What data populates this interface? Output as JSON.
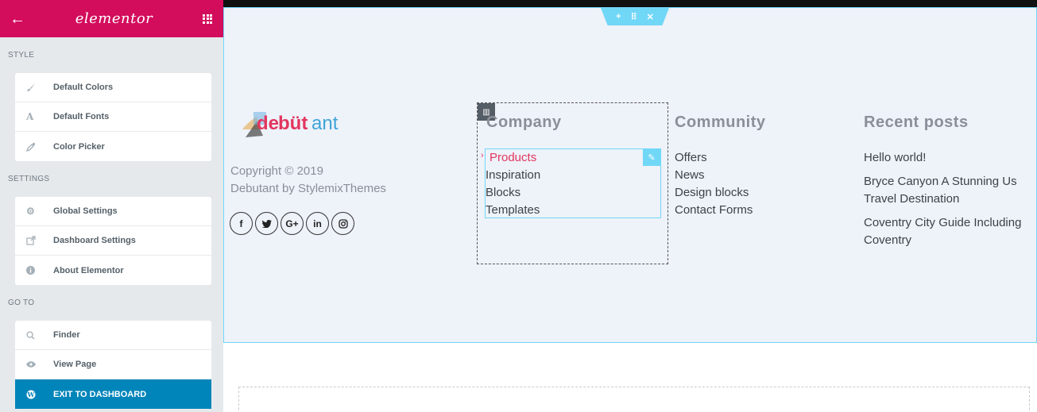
{
  "app": {
    "logo": "elementor"
  },
  "sidebar": {
    "style_title": "STYLE",
    "style_items": [
      {
        "label": "Default Colors",
        "icon": "brush-icon"
      },
      {
        "label": "Default Fonts",
        "icon": "font-icon"
      },
      {
        "label": "Color Picker",
        "icon": "eyedropper-icon"
      }
    ],
    "settings_title": "SETTINGS",
    "settings_items": [
      {
        "label": "Global Settings",
        "icon": "cogs-icon"
      },
      {
        "label": "Dashboard Settings",
        "icon": "external-link-icon"
      },
      {
        "label": "About Elementor",
        "icon": "info-icon"
      }
    ],
    "goto_title": "GO TO",
    "goto_items": [
      {
        "label": "Finder",
        "icon": "search-icon"
      },
      {
        "label": "View Page",
        "icon": "eye-icon"
      },
      {
        "label": "EXIT TO DASHBOARD",
        "icon": "wordpress-icon"
      }
    ]
  },
  "footer": {
    "brand": "debütant",
    "copyright_line1": "Copyright © 2019",
    "copyright_line2": "Debutant by StylemixThemes",
    "socials": [
      "f",
      "t",
      "G+",
      "in",
      "ig"
    ],
    "company": {
      "title": "Company",
      "links": [
        "Products",
        "Inspiration",
        "Blocks",
        "Templates"
      ]
    },
    "community": {
      "title": "Community",
      "links": [
        "Offers",
        "News",
        "Design blocks",
        "Contact Forms"
      ]
    },
    "recent": {
      "title": "Recent posts",
      "posts": [
        "Hello world!",
        "Bryce Canyon A Stunning Us Travel Destination",
        "Coventry City Guide Including Coventry"
      ]
    }
  },
  "colors": {
    "brand": "#d30c5c",
    "editor_accent": "#71d7f7",
    "exit_button": "#0085ba",
    "active_link": "#e2365f"
  }
}
